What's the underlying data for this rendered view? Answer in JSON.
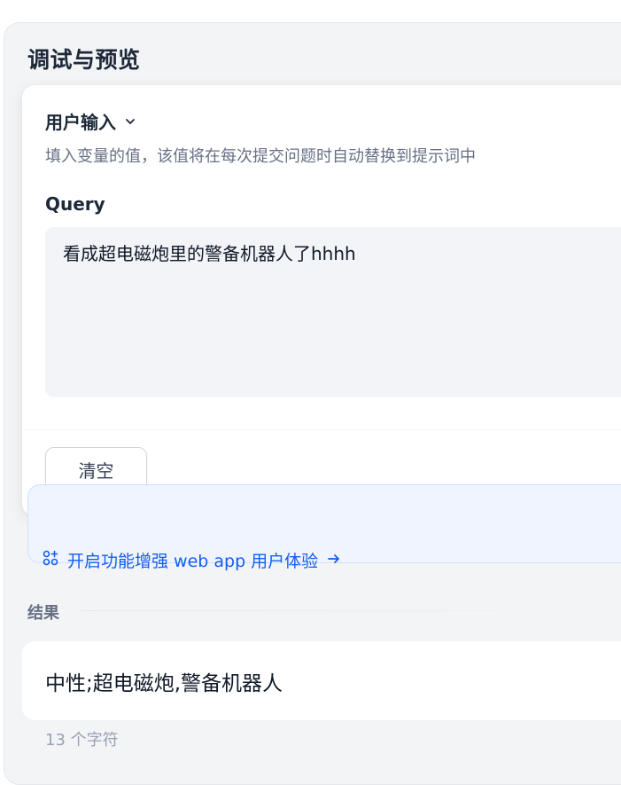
{
  "panel": {
    "title": "调试与预览"
  },
  "user_input": {
    "title": "用户输入",
    "hint": "填入变量的值，该值将在每次提交问题时自动替换到提示词中",
    "query_label": "Query",
    "query_value": "看成超电磁炮里的警备机器人了hhhh",
    "clear_label": "清空"
  },
  "enhance": {
    "label": "开启功能增强 web app 用户体验"
  },
  "result": {
    "section_label": "结果",
    "text": "中性;超电磁炮,警备机器人",
    "char_count": "13 个字符"
  },
  "colors": {
    "accent": "#155eef",
    "panel_bg": "#f3f4f6",
    "enhance_bg": "#eff4ff"
  },
  "icons": {
    "chevron": "chevron-down-icon",
    "feature": "feature-grid-icon",
    "arrow": "arrow-right-icon"
  }
}
